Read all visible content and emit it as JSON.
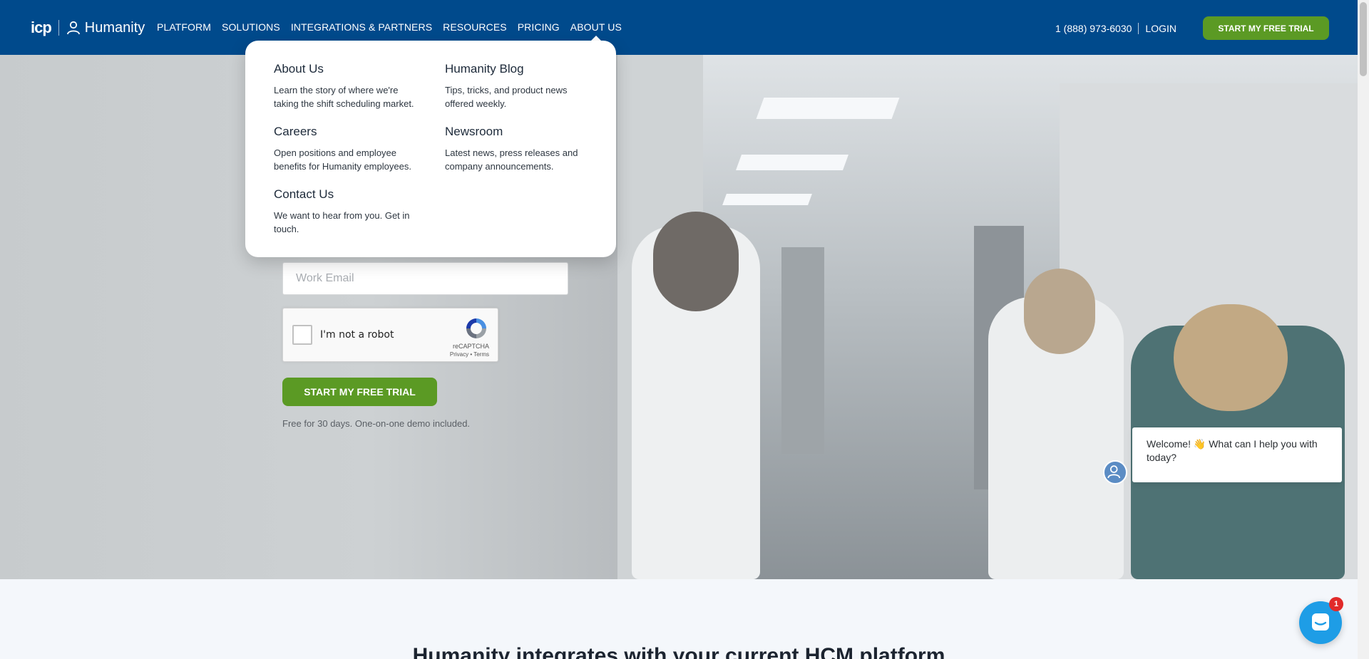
{
  "header": {
    "logo_brand": "icp",
    "logo_product": "Humanity",
    "nav": [
      "PLATFORM",
      "SOLUTIONS",
      "INTEGRATIONS & PARTNERS",
      "RESOURCES",
      "PRICING",
      "ABOUT US"
    ],
    "active_nav": "ABOUT US",
    "phone": "1 (888) 973-6030",
    "login": "LOGIN",
    "cta": "START MY FREE TRIAL"
  },
  "dropdown": {
    "items": [
      {
        "title": "About Us",
        "desc": "Learn the story of where we're taking the shift scheduling market."
      },
      {
        "title": "Humanity Blog",
        "desc": "Tips, tricks, and product news offered weekly."
      },
      {
        "title": "Careers",
        "desc": "Open positions and employee benefits for Humanity employees."
      },
      {
        "title": "Newsroom",
        "desc": "Latest news, press releases and company announcements."
      },
      {
        "title": "Contact Us",
        "desc": "We want to hear from you. Get in touch."
      }
    ]
  },
  "hero": {
    "email_placeholder": "Work Email",
    "recaptcha_label": "I'm not a robot",
    "recaptcha_brand": "reCAPTCHA",
    "recaptcha_links": "Privacy • Terms",
    "cta": "START MY FREE TRIAL",
    "note": "Free for 30 days. One-on-one demo included."
  },
  "chat": {
    "message": "Welcome! 👋 What can I help you with today?",
    "badge_count": "1"
  },
  "section": {
    "heading": "Humanity integrates with your current HCM platform"
  },
  "colors": {
    "header_bg": "#004a8c",
    "cta_green": "#5b9a24",
    "chat_blue": "#1e9de6"
  }
}
